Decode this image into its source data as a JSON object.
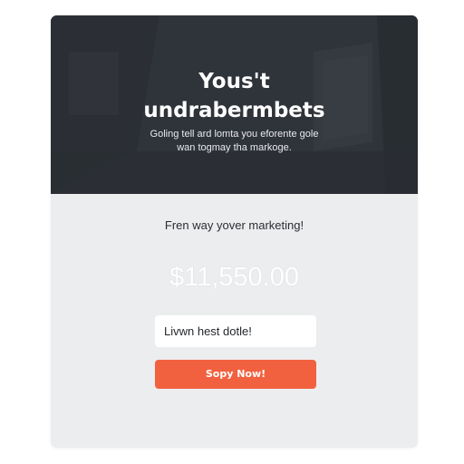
{
  "hero": {
    "title_line1": "Yous't",
    "title_line2": "undrabermbets",
    "subtitle_line1": "Goling tell ard lomta you eforente gole",
    "subtitle_line2": "wan togmay tha markoge."
  },
  "main": {
    "tagline": "Fren way yover marketing!",
    "price": "$11,550.00",
    "input_value": "Livwn hest dotle!",
    "cta_label": "Sopy Now!"
  },
  "colors": {
    "hero_bg": "#2d3138",
    "panel_bg": "#ecedef",
    "cta_bg": "#f2613f",
    "price_text": "#ffffff"
  }
}
